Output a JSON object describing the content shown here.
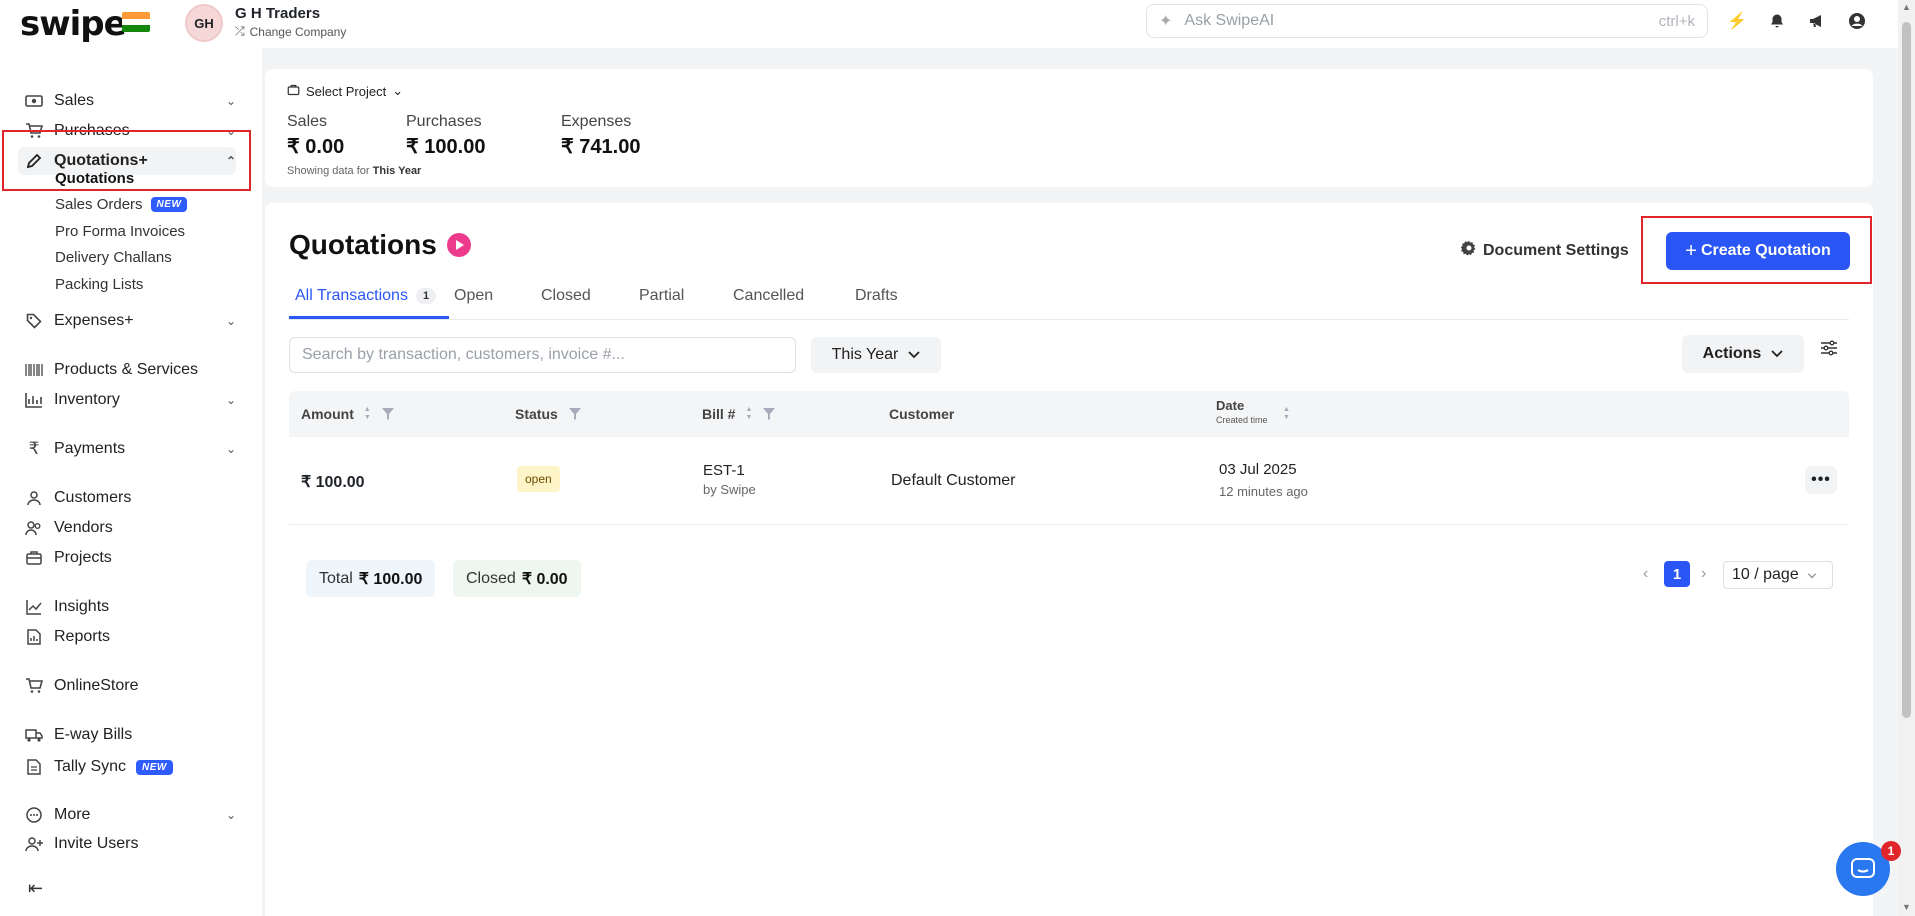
{
  "app": {
    "logo": "swipe",
    "company": "G H Traders",
    "avatar_initials": "GH",
    "change_company": "Change Company",
    "ask_placeholder": "Ask SwipeAI",
    "ask_shortcut": "ctrl+k"
  },
  "sidebar": {
    "items": [
      {
        "label": "Sales",
        "icon": "cash-icon"
      },
      {
        "label": "Purchases",
        "icon": "cart-icon"
      },
      {
        "label": "Quotations+",
        "icon": "pencil-icon"
      },
      {
        "label": "Expenses+",
        "icon": "tag-icon"
      },
      {
        "label": "Products & Services",
        "icon": "barcode-icon"
      },
      {
        "label": "Inventory",
        "icon": "inventory-icon"
      },
      {
        "label": "Payments",
        "icon": "rupee-icon"
      },
      {
        "label": "Customers",
        "icon": "user-icon"
      },
      {
        "label": "Vendors",
        "icon": "users-icon"
      },
      {
        "label": "Projects",
        "icon": "briefcase-icon"
      },
      {
        "label": "Insights",
        "icon": "chart-icon"
      },
      {
        "label": "Reports",
        "icon": "report-icon"
      },
      {
        "label": "OnlineStore",
        "icon": "store-icon"
      },
      {
        "label": "E-way Bills",
        "icon": "truck-icon"
      },
      {
        "label": "Tally Sync",
        "icon": "document-icon"
      },
      {
        "label": "More",
        "icon": "more-circle-icon"
      },
      {
        "label": "Invite Users",
        "icon": "user-plus-icon"
      }
    ],
    "sub_items": [
      "Quotations",
      "Sales Orders",
      "Pro Forma Invoices",
      "Delivery Challans",
      "Packing Lists"
    ],
    "new_badge": "NEW"
  },
  "summary": {
    "project_select": "Select Project",
    "sales_label": "Sales",
    "sales_value": "₹ 0.00",
    "purchases_label": "Purchases",
    "purchases_value": "₹ 100.00",
    "expenses_label": "Expenses",
    "expenses_value": "₹ 741.00",
    "showing_prefix": "Showing data for",
    "showing_period": "This Year"
  },
  "main": {
    "title": "Quotations",
    "document_settings": "Document Settings",
    "create_button": "Create Quotation",
    "tabs": [
      "All Transactions",
      "Open",
      "Closed",
      "Partial",
      "Cancelled",
      "Drafts"
    ],
    "all_count": "1",
    "search_placeholder": "Search by transaction, customers, invoice #...",
    "period": "This Year",
    "actions": "Actions",
    "columns": {
      "amount": "Amount",
      "status": "Status",
      "bill": "Bill #",
      "customer": "Customer",
      "date": "Date",
      "date_sub": "Created time"
    },
    "rows": [
      {
        "amount": "₹ 100.00",
        "status": "open",
        "bill": "EST-1",
        "bill_by": "by Swipe",
        "customer": "Default Customer",
        "date": "03 Jul 2025",
        "ago": "12 minutes ago"
      }
    ],
    "total_label": "Total",
    "total_value": "₹ 100.00",
    "closed_label": "Closed",
    "closed_value": "₹ 0.00",
    "page": "1",
    "per_page": "10 / page"
  },
  "chat_badge": "1",
  "colors": {
    "accent": "#2a56f5",
    "highlight": "#e0262b",
    "new_badge": "#2f5cff"
  }
}
